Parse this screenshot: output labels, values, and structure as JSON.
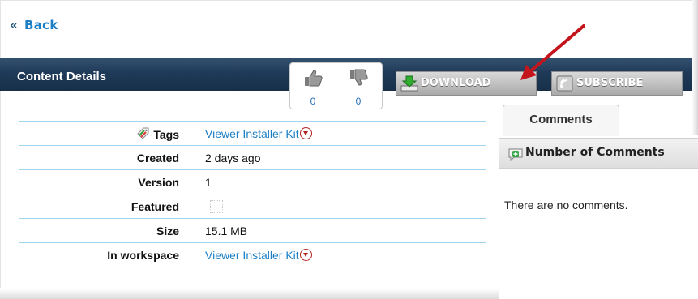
{
  "nav": {
    "back_chevron": "«",
    "back_label": "Back"
  },
  "header": {
    "title": "Content Details"
  },
  "votes": {
    "up_count": "0",
    "down_count": "0",
    "up_icon": "thumbs-up-icon",
    "down_icon": "thumbs-down-icon"
  },
  "actions": {
    "download_label": "DOWNLOAD",
    "subscribe_label": "SUBSCRIBE"
  },
  "details": {
    "tags_label": "Tags",
    "tags_value": "Viewer Installer Kit",
    "created_label": "Created",
    "created_value": "2 days ago",
    "version_label": "Version",
    "version_value": "1",
    "featured_label": "Featured",
    "size_label": "Size",
    "size_value": "15.1 MB",
    "workspace_label": "In workspace",
    "workspace_value": "Viewer Installer Kit"
  },
  "comments": {
    "tab_label": "Comments",
    "header": "Number of Comments",
    "empty_text": "There are no comments."
  },
  "colors": {
    "link": "#1c7fc6",
    "header_bar": "#1f3a58",
    "annotation_arrow": "#c4151c"
  }
}
